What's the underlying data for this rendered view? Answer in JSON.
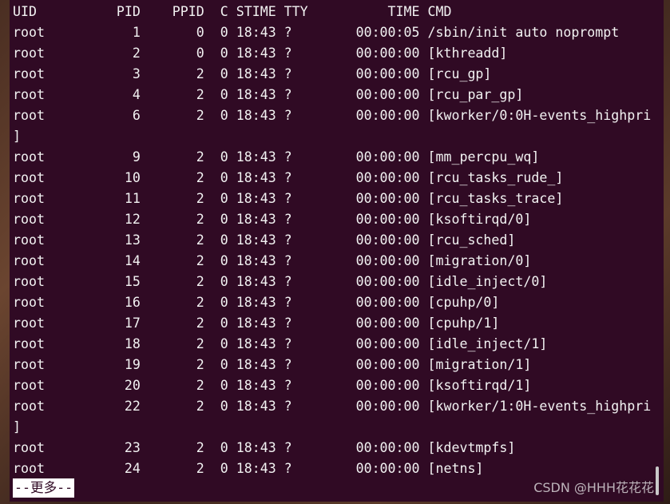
{
  "terminal": {
    "header": "UID          PID    PPID  C STIME TTY          TIME CMD",
    "lines": [
      "root           1       0  0 18:43 ?        00:00:05 /sbin/init auto noprompt",
      "root           2       0  0 18:43 ?        00:00:00 [kthreadd]",
      "root           3       2  0 18:43 ?        00:00:00 [rcu_gp]",
      "root           4       2  0 18:43 ?        00:00:00 [rcu_par_gp]",
      "root           6       2  0 18:43 ?        00:00:00 [kworker/0:0H-events_highpri",
      "]",
      "root           9       2  0 18:43 ?        00:00:00 [mm_percpu_wq]",
      "root          10       2  0 18:43 ?        00:00:00 [rcu_tasks_rude_]",
      "root          11       2  0 18:43 ?        00:00:00 [rcu_tasks_trace]",
      "root          12       2  0 18:43 ?        00:00:00 [ksoftirqd/0]",
      "root          13       2  0 18:43 ?        00:00:00 [rcu_sched]",
      "root          14       2  0 18:43 ?        00:00:00 [migration/0]",
      "root          15       2  0 18:43 ?        00:00:00 [idle_inject/0]",
      "root          16       2  0 18:43 ?        00:00:00 [cpuhp/0]",
      "root          17       2  0 18:43 ?        00:00:00 [cpuhp/1]",
      "root          18       2  0 18:43 ?        00:00:00 [idle_inject/1]",
      "root          19       2  0 18:43 ?        00:00:00 [migration/1]",
      "root          20       2  0 18:43 ?        00:00:00 [ksoftirqd/1]",
      "root          22       2  0 18:43 ?        00:00:00 [kworker/1:0H-events_highpri",
      "]",
      "root          23       2  0 18:43 ?        00:00:00 [kdevtmpfs]",
      "root          24       2  0 18:43 ?        00:00:00 [netns]"
    ],
    "pager_prompt": "--更多--"
  },
  "watermark": "CSDN @HHH花花花",
  "colors": {
    "terminal_bg": "#300a24",
    "text": "#f2f2f2",
    "prompt_bg": "#ffffff"
  }
}
